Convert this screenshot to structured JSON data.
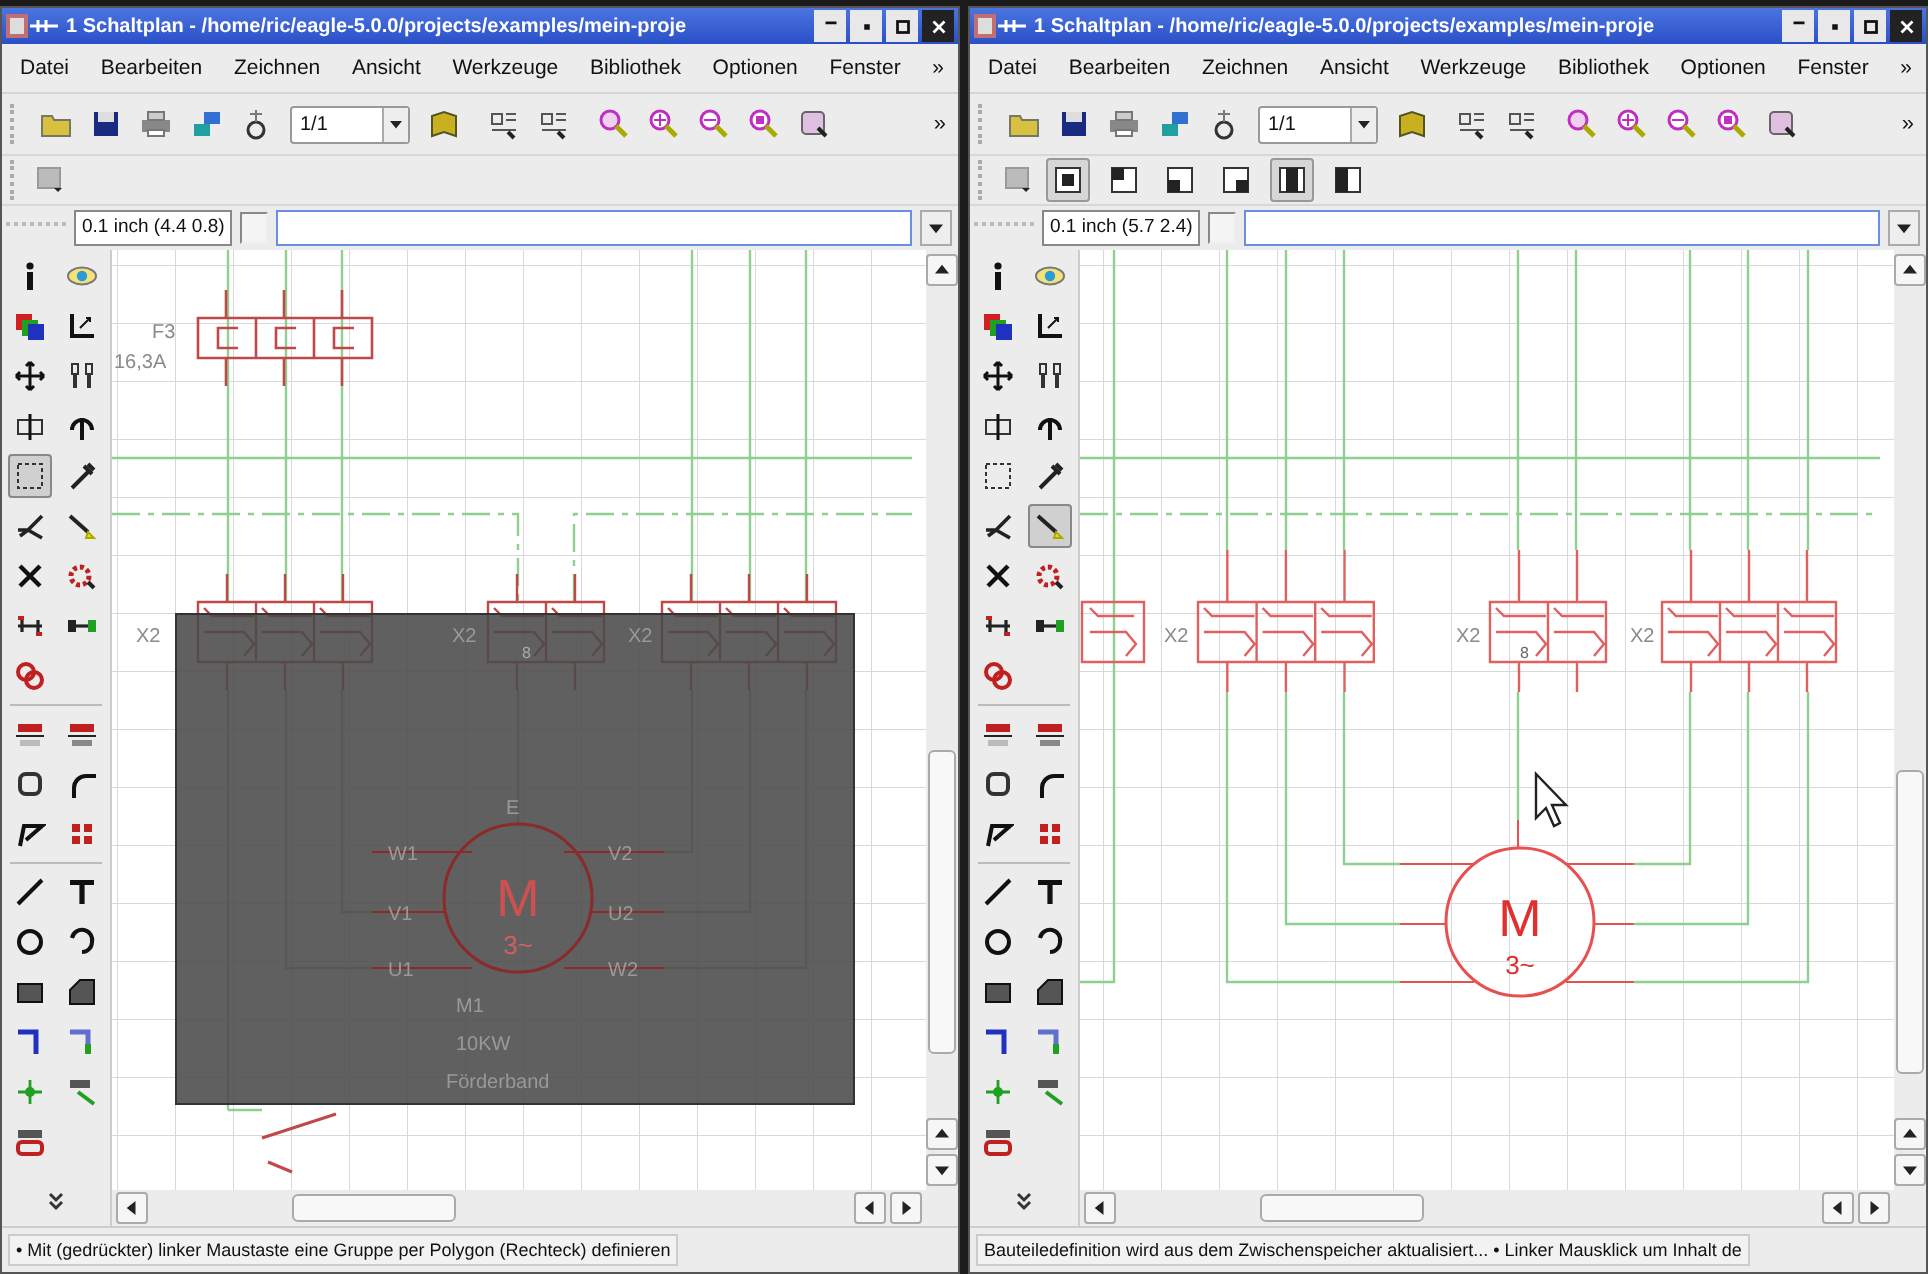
{
  "windows": [
    {
      "title": "1 Schaltplan - /home/ric/eagle-5.0.0/projects/examples/mein-proje",
      "menu": [
        "Datei",
        "Bearbeiten",
        "Zeichnen",
        "Ansicht",
        "Werkzeuge",
        "Bibliothek",
        "Optionen",
        "Fenster"
      ],
      "menu_more": "»",
      "zoom_value": "1/1",
      "toolbar_more": "»",
      "coordinates": "0.1 inch (4.4 0.8)",
      "tools": [
        {
          "selected": false
        },
        {
          "selected": false
        },
        {
          "selected": false
        },
        {
          "selected": false
        },
        {
          "selected": false
        },
        {
          "selected": false
        },
        {
          "selected": false
        },
        {
          "selected": false
        },
        {
          "selected": true
        },
        {
          "selected": false
        },
        {
          "selected": false
        },
        {
          "selected": false
        },
        {
          "selected": false
        },
        {
          "selected": false
        },
        {
          "selected": false
        },
        {
          "selected": false
        },
        {
          "selected": false
        },
        {
          "selected": false
        },
        {
          "selected": false
        },
        {
          "selected": false
        },
        {
          "selected": false
        },
        {
          "selected": false
        },
        {
          "selected": false
        },
        {
          "selected": false
        },
        {
          "selected": false
        },
        {
          "selected": false
        },
        {
          "selected": false
        },
        {
          "selected": false
        },
        {
          "selected": false
        },
        {
          "selected": false
        },
        {
          "selected": false
        },
        {
          "selected": false
        },
        {
          "selected": false
        },
        {
          "selected": false
        }
      ],
      "schematic": {
        "kind": "overview",
        "group_selected": true,
        "fuse": {
          "name": "F3",
          "rating": "16,3A"
        },
        "terminals": [
          {
            "label": "X2"
          },
          {
            "label": "X2",
            "pin": "8"
          },
          {
            "label": "X2"
          }
        ],
        "motor": {
          "symbol": "M",
          "phases": "3~",
          "mark": "E",
          "terminals": [
            "W1",
            "V1",
            "U1",
            "V2",
            "U2",
            "W2"
          ],
          "name": "M1",
          "power": "10KW",
          "description": "Förderband"
        }
      },
      "status": "• Mit (gedrückter) linker Maustaste eine Gruppe per Polygon (Rechteck) definieren"
    },
    {
      "title": "1 Schaltplan - /home/ric/eagle-5.0.0/projects/examples/mein-proje",
      "menu": [
        "Datei",
        "Bearbeiten",
        "Zeichnen",
        "Ansicht",
        "Werkzeuge",
        "Bibliothek",
        "Optionen",
        "Fenster"
      ],
      "menu_more": "»",
      "zoom_value": "1/1",
      "toolbar_more": "»",
      "coordinates": "0.1 inch (5.7 2.4)",
      "layout_buttons": [
        {
          "selected": true
        },
        {
          "selected": false
        },
        {
          "selected": false
        },
        {
          "selected": false
        },
        {
          "selected": true
        },
        {
          "selected": false
        }
      ],
      "tools": [
        {
          "selected": false
        },
        {
          "selected": false
        },
        {
          "selected": false
        },
        {
          "selected": false
        },
        {
          "selected": false
        },
        {
          "selected": false
        },
        {
          "selected": false
        },
        {
          "selected": false
        },
        {
          "selected": false
        },
        {
          "selected": false
        },
        {
          "selected": false
        },
        {
          "selected": true
        },
        {
          "selected": false
        },
        {
          "selected": false
        },
        {
          "selected": false
        },
        {
          "selected": false
        },
        {
          "selected": false
        },
        {
          "selected": false
        },
        {
          "selected": false
        },
        {
          "selected": false
        },
        {
          "selected": false
        },
        {
          "selected": false
        },
        {
          "selected": false
        },
        {
          "selected": false
        },
        {
          "selected": false
        },
        {
          "selected": false
        },
        {
          "selected": false
        },
        {
          "selected": false
        },
        {
          "selected": false
        },
        {
          "selected": false
        },
        {
          "selected": false
        },
        {
          "selected": false
        },
        {
          "selected": false
        },
        {
          "selected": false
        }
      ],
      "schematic": {
        "kind": "detail",
        "group_selected": false,
        "terminals": [
          {
            "label": "X2"
          },
          {
            "label": "X2",
            "pin": "8"
          },
          {
            "label": "X2"
          }
        ],
        "motor": {
          "symbol": "M",
          "phases": "3~"
        }
      },
      "status": "Bauteiledefinition wird aus dem Zwischenspeicher aktualisiert... • Linker Mausklick um Inhalt de"
    }
  ]
}
